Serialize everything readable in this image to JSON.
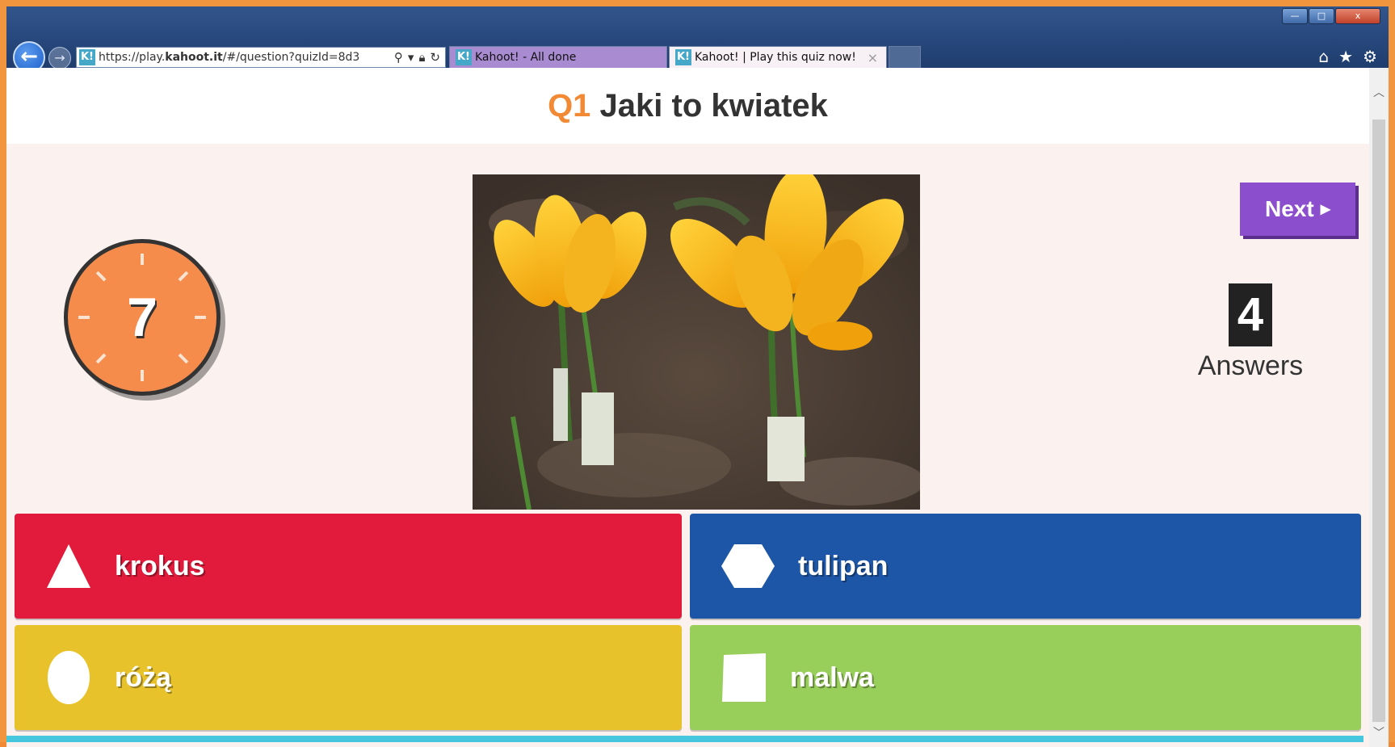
{
  "browser": {
    "address_url_prefix": "https://play.",
    "address_url_domain": "kahoot.it",
    "address_url_suffix": "/#/question?quizId=8d3",
    "logo_text": "K!",
    "tabs": [
      {
        "title": "Kahoot! - All done"
      },
      {
        "title": "Kahoot! | Play this quiz now!"
      }
    ],
    "window_controls": {
      "minimize": "—",
      "restore": "□",
      "close": "x"
    },
    "tab_close": "×"
  },
  "question": {
    "number": "Q1",
    "text": "Jaki to kwiatek"
  },
  "timer": {
    "value": "7"
  },
  "next_button": {
    "label": "Next"
  },
  "answers_counter": {
    "count": "4",
    "label": "Answers"
  },
  "answers": [
    {
      "label": "krokus",
      "shape": "triangle-icon",
      "color": "#e21b3c"
    },
    {
      "label": "tulipan",
      "shape": "hexagon-icon",
      "color": "#1d56a6"
    },
    {
      "label": "różą",
      "shape": "ellipse-icon",
      "color": "#e8c22b"
    },
    {
      "label": "malwa",
      "shape": "square-icon",
      "color": "#98ce5a"
    }
  ],
  "colors": {
    "accent": "#f28a35",
    "next_button": "#8b4fce",
    "page_bg": "#fbf1ef"
  }
}
